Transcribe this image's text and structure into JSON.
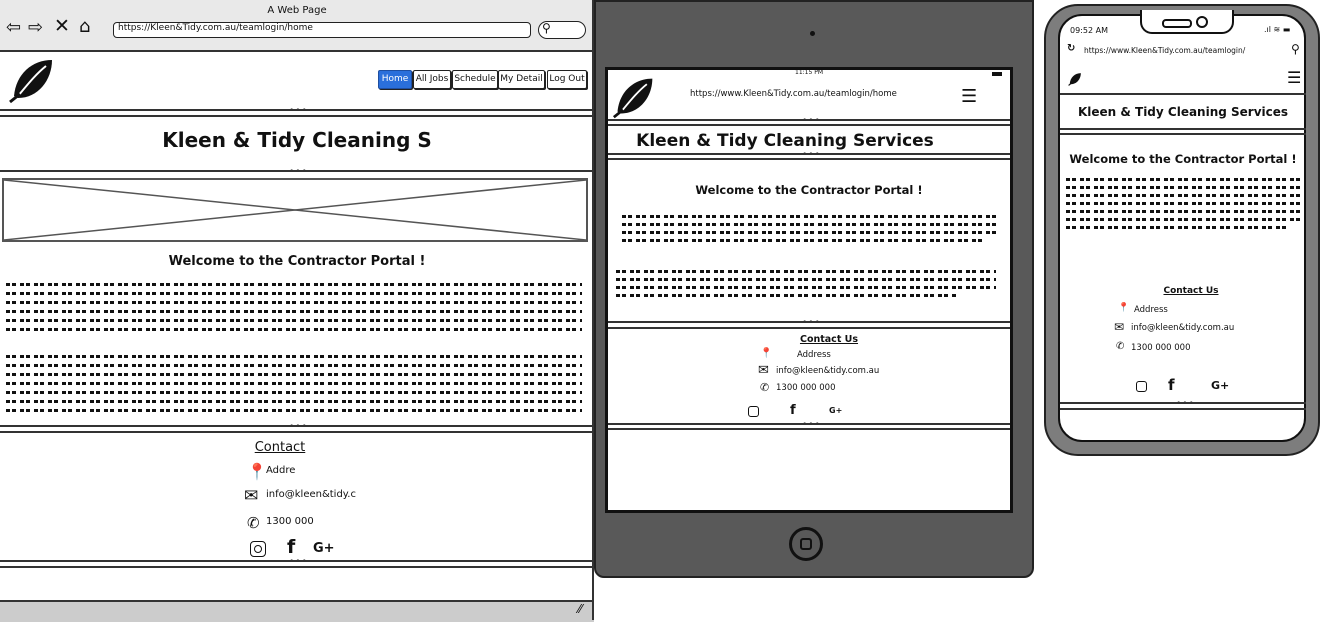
{
  "desktop": {
    "window_title": "A Web Page",
    "url": "https://Kleen&Tidy.com.au/teamlogin/home",
    "nav": [
      "Home",
      "All Jobs",
      "Schedule",
      "My Detail",
      "Log Out"
    ],
    "title": "Kleen & Tidy Cleaning S",
    "welcome": "Welcome to the Contractor Portal !",
    "contact_title": "Contact",
    "address": "Addre",
    "email": "info@kleen&tidy.c",
    "phone": "1300 000"
  },
  "tablet": {
    "status_time": "11:15 PM",
    "url": "https://www.Kleen&Tidy.com.au/teamlogin/home",
    "title": "Kleen & Tidy Cleaning Services",
    "welcome": "Welcome to the Contractor Portal !",
    "contact_title": "Contact Us",
    "address": "Address",
    "email": "info@kleen&tidy.com.au",
    "phone": "1300 000 000"
  },
  "phone": {
    "status_time": "09:52 AM",
    "url": "https://www.Kleen&Tidy.com.au/teamlogin/",
    "title": "Kleen & Tidy Cleaning Services",
    "welcome": "Welcome to the Contractor Portal !",
    "contact_title": "Contact Us",
    "address": "Address",
    "email": "info@kleen&tidy.com.au",
    "phone": "1300 000 000"
  },
  "icons": {
    "instagram": "instagram-icon",
    "facebook": "f",
    "google_plus": "G+"
  }
}
